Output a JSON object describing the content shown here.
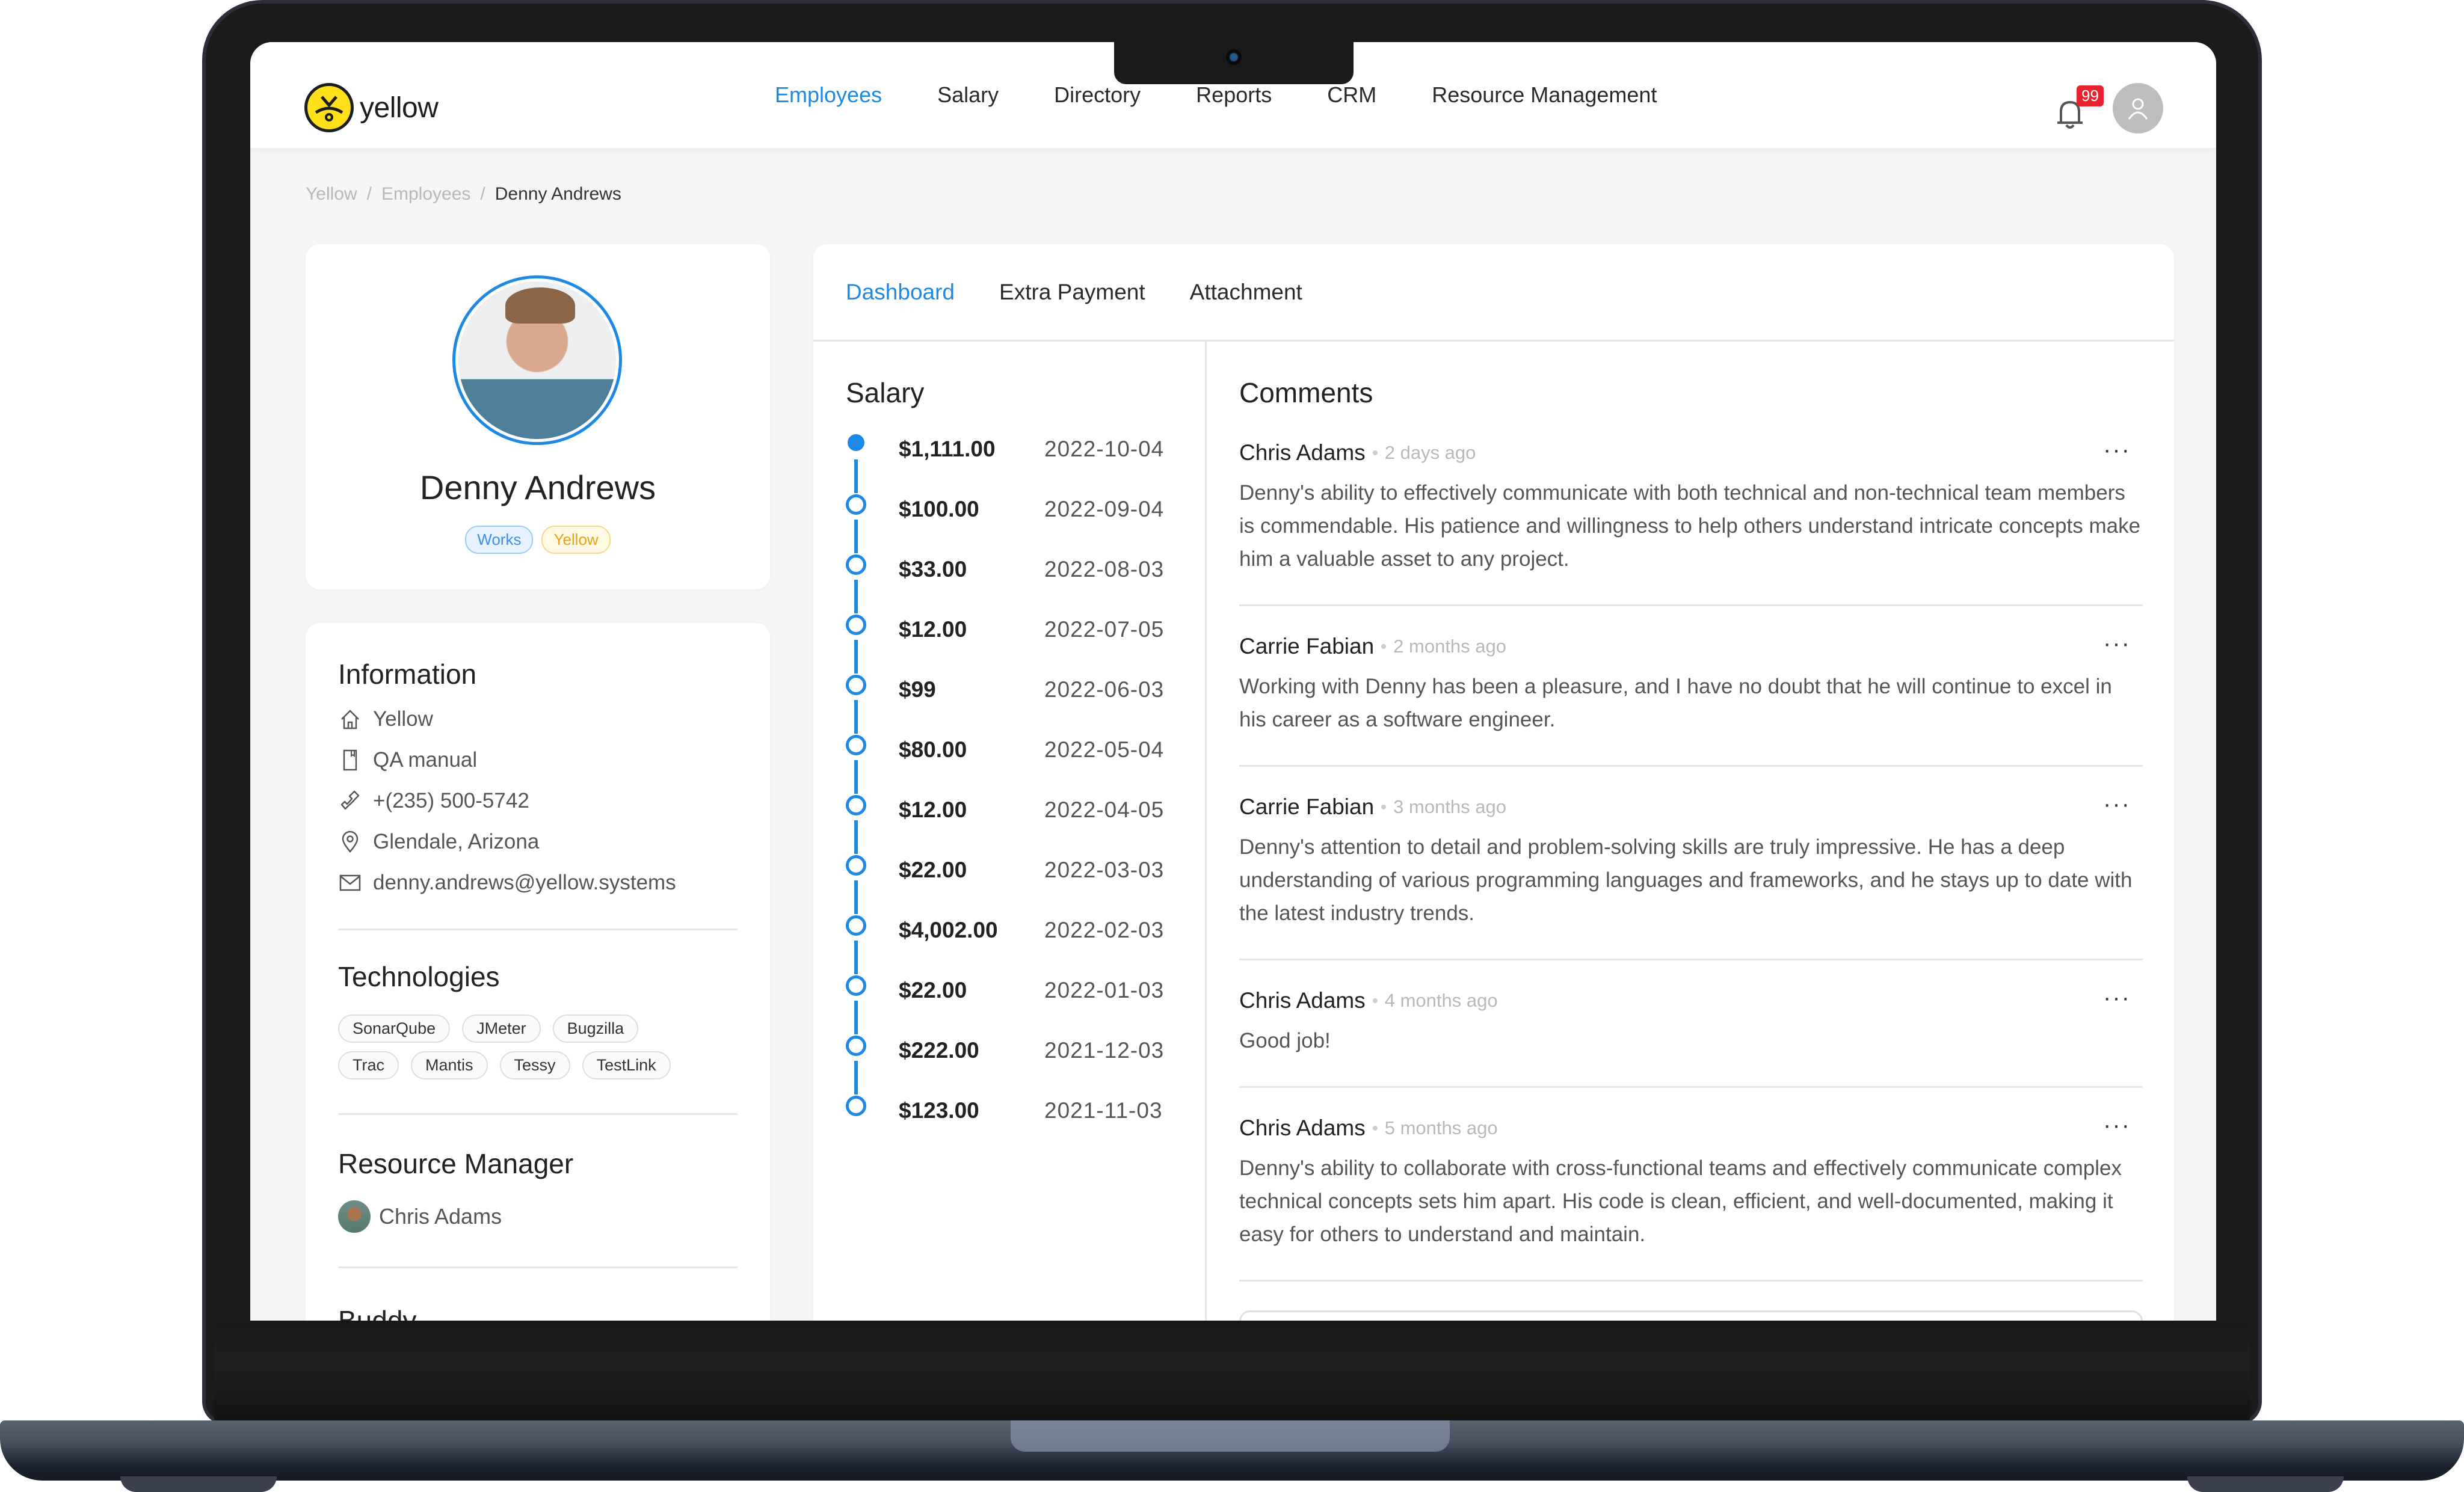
{
  "app": {
    "brand": "yellow",
    "accent_color": "#1e88e5",
    "logo_color": "#ffe01b"
  },
  "nav": {
    "items": [
      {
        "label": "Employees",
        "active": true
      },
      {
        "label": "Salary",
        "active": false
      },
      {
        "label": "Directory",
        "active": false
      },
      {
        "label": "Reports",
        "active": false
      },
      {
        "label": "CRM",
        "active": false
      },
      {
        "label": "Resource Management",
        "active": false
      }
    ],
    "notifications_count": "99",
    "notification_icon": "bell-icon",
    "user_icon": "user-icon"
  },
  "breadcrumb": {
    "items": [
      "Yellow",
      "Employees",
      "Denny Andrews"
    ],
    "separator": "/"
  },
  "profile": {
    "name": "Denny Andrews",
    "tags": [
      {
        "label": "Works",
        "color": "#3d8ee8"
      },
      {
        "label": "Yellow",
        "color": "#e8a21a"
      }
    ]
  },
  "information": {
    "title": "Information",
    "rows": [
      {
        "icon": "home-icon",
        "value": "Yellow"
      },
      {
        "icon": "book-icon",
        "value": "QA manual"
      },
      {
        "icon": "phone-icon",
        "value": "+(235) 500-5742"
      },
      {
        "icon": "location-pin-icon",
        "value": "Glendale, Arizona"
      },
      {
        "icon": "mail-icon",
        "value": "denny.andrews@yellow.systems"
      }
    ]
  },
  "technologies": {
    "title": "Technologies",
    "items": [
      "SonarQube",
      "JMeter",
      "Bugzilla",
      "Trac",
      "Mantis",
      "Tessy",
      "TestLink"
    ]
  },
  "resource_manager": {
    "title": "Resource Manager",
    "name": "Chris Adams"
  },
  "buddy": {
    "title": "Buddy"
  },
  "tabs": [
    {
      "label": "Dashboard",
      "active": true
    },
    {
      "label": "Extra Payment",
      "active": false
    },
    {
      "label": "Attachment",
      "active": false
    }
  ],
  "salary": {
    "title": "Salary",
    "entries": [
      {
        "amount": "$1,111.00",
        "date": "2022-10-04",
        "current": true
      },
      {
        "amount": "$100.00",
        "date": "2022-09-04",
        "current": false
      },
      {
        "amount": "$33.00",
        "date": "2022-08-03",
        "current": false
      },
      {
        "amount": "$12.00",
        "date": "2022-07-05",
        "current": false
      },
      {
        "amount": "$99",
        "date": "2022-06-03",
        "current": false
      },
      {
        "amount": "$80.00",
        "date": "2022-05-04",
        "current": false
      },
      {
        "amount": "$12.00",
        "date": "2022-04-05",
        "current": false
      },
      {
        "amount": "$22.00",
        "date": "2022-03-03",
        "current": false
      },
      {
        "amount": "$4,002.00",
        "date": "2022-02-03",
        "current": false
      },
      {
        "amount": "$22.00",
        "date": "2022-01-03",
        "current": false
      },
      {
        "amount": "$222.00",
        "date": "2021-12-03",
        "current": false
      },
      {
        "amount": "$123.00",
        "date": "2021-11-03",
        "current": false
      }
    ]
  },
  "comments": {
    "title": "Comments",
    "items": [
      {
        "author": "Chris Adams",
        "time": "2 days ago",
        "text": "Denny's ability to effectively communicate with both technical and non-technical team members is commendable. His patience and willingness to help others understand intricate concepts make him a valuable asset to any project."
      },
      {
        "author": "Carrie Fabian",
        "time": "2 months ago",
        "text": "Working with Denny has been a pleasure, and I have no doubt that he will continue to excel in his career as a software engineer."
      },
      {
        "author": "Carrie Fabian",
        "time": "3 months ago",
        "text": "Denny's attention to detail and problem-solving skills are truly impressive. He has a deep understanding of various programming languages and frameworks, and he stays up to date with the latest industry trends."
      },
      {
        "author": "Chris Adams",
        "time": "4 months ago",
        "text": "Good job!"
      },
      {
        "author": "Chris Adams",
        "time": "5 months ago",
        "text": "Denny's ability to collaborate with cross-functional teams and effectively communicate complex technical concepts sets him apart. His code is clean, efficient, and well-documented, making it easy for others to understand and maintain."
      }
    ],
    "more_label": "···",
    "input_value": "",
    "input_placeholder": ""
  }
}
